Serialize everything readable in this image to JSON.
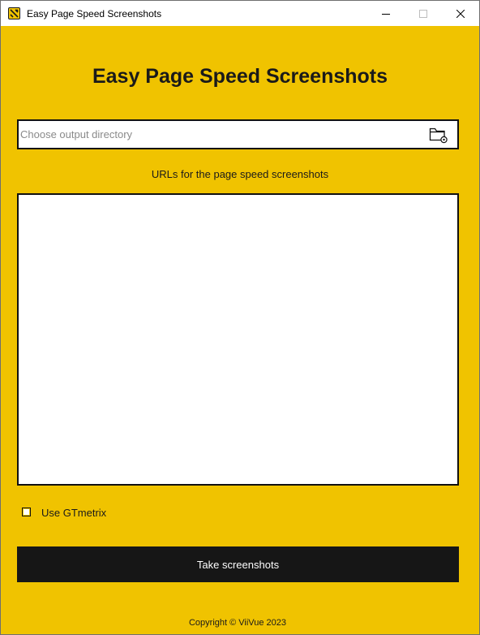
{
  "window": {
    "title": "Easy Page Speed Screenshots",
    "icon": "app-icon",
    "controls": [
      "minimize-icon",
      "maximize-icon",
      "close-icon"
    ]
  },
  "main": {
    "heading": "Easy Page Speed Screenshots",
    "directory": {
      "value": "",
      "placeholder": "Choose output directory",
      "browse_icon": "folder-icon"
    },
    "urls_label": "URLs for the page speed screenshots",
    "urls_value": "",
    "gtmetrix": {
      "label": "Use GTmetrix",
      "checked": false
    },
    "take_button_label": "Take screenshots",
    "copyright": "Copyright © ViiVue 2023"
  },
  "colors": {
    "background": "#f0c300",
    "button": "#161616",
    "button_text": "#ffffff",
    "border": "#111111"
  }
}
